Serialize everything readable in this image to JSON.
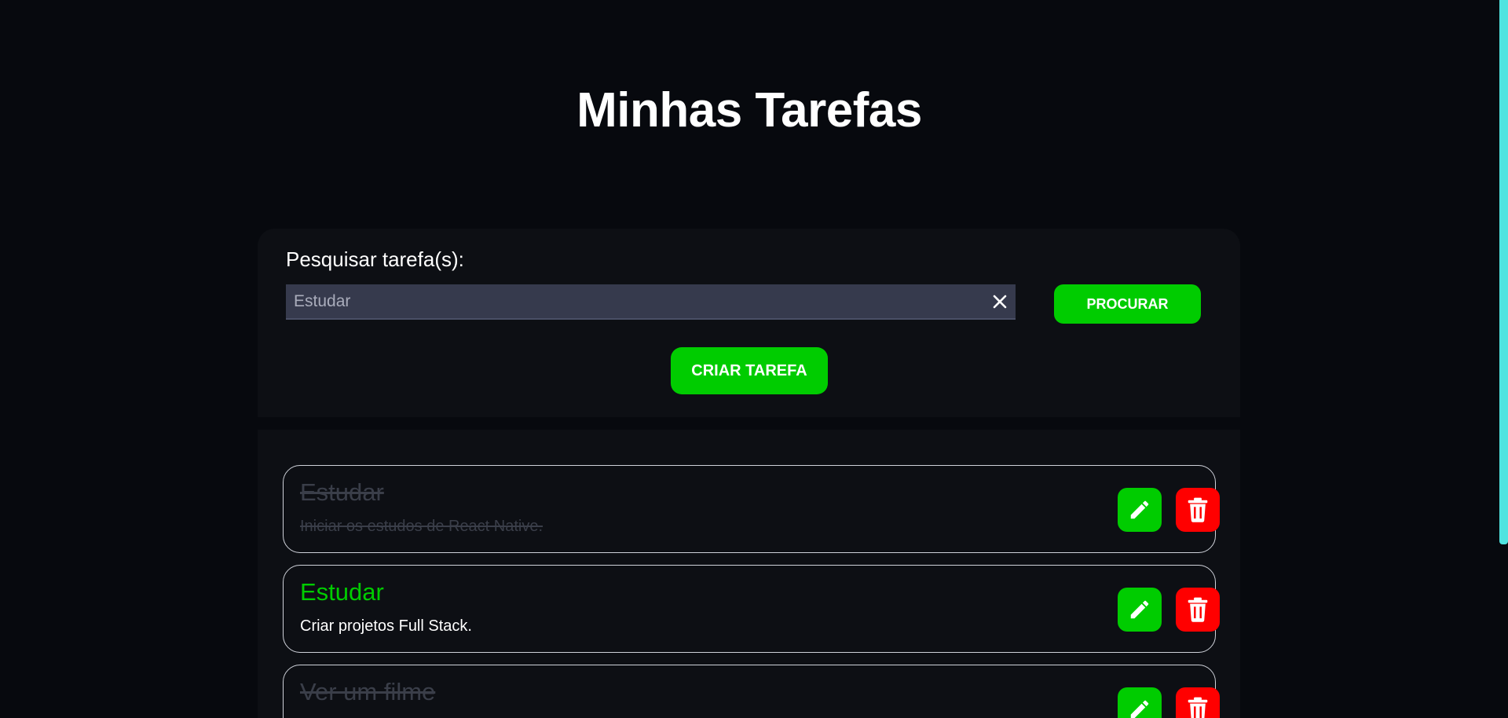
{
  "header": {
    "title": "Minhas Tarefas"
  },
  "search": {
    "label": "Pesquisar tarefa(s):",
    "placeholder": "Estudar",
    "search_button": "PROCURAR",
    "create_button": "CRIAR TAREFA"
  },
  "tasks": [
    {
      "title": "Estudar",
      "description": "Iniciar os estudos de React Native.",
      "completed": true
    },
    {
      "title": "Estudar",
      "description": "Criar projetos Full Stack.",
      "completed": false
    },
    {
      "title": "Ver um filme",
      "description": "",
      "completed": true
    }
  ],
  "icons": {
    "clear": "close-icon",
    "edit": "pencil-icon",
    "delete": "trash-icon"
  },
  "colors": {
    "background": "#07090e",
    "panel": "#0d0f14",
    "accent_green": "#00cc00",
    "delete_red": "#ff0000",
    "search_field": "#363a4d",
    "completed_text": "#3a3e49",
    "scrollbar": "#4fe3e0"
  }
}
